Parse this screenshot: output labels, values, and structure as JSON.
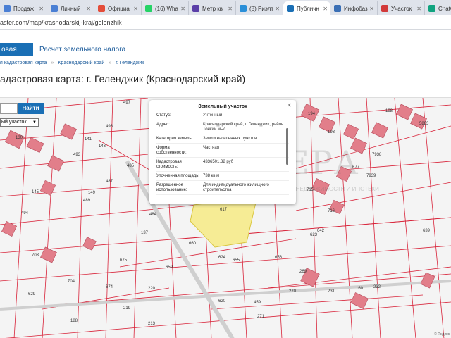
{
  "browser": {
    "tabs": [
      {
        "label": "Продаж",
        "color": "#4a7fd4"
      },
      {
        "label": "Личный",
        "color": "#4a7fd4"
      },
      {
        "label": "Официа",
        "color": "#e44d3a"
      },
      {
        "label": "(16) Wha",
        "color": "#25d366"
      },
      {
        "label": "Метр кв",
        "color": "#5b3fa8"
      },
      {
        "label": "(8) Риэлт",
        "color": "#2a8fd8"
      },
      {
        "label": "Публичн",
        "color": "#1a6fb5",
        "active": true
      },
      {
        "label": "Инфобаз",
        "color": "#3a6fb5"
      },
      {
        "label": "Участок",
        "color": "#d23a3a"
      },
      {
        "label": "ChatGPT",
        "color": "#10a37f"
      }
    ],
    "url": "aster.com/map/krasnodarskij-kraj/gelenzhik"
  },
  "site": {
    "nav_active": "овая карта",
    "nav_link": "Расчет земельного налога"
  },
  "breadcrumb": {
    "items": [
      "я кадастровая карта",
      "Краснодарский край",
      "г. Геленджик"
    ]
  },
  "page_title": "адастровая карта: г. Геленджик (Краснодарский край)",
  "map_controls": {
    "search_button": "Найти",
    "type_select": "ый участок"
  },
  "popup": {
    "title": "Земельный участок",
    "rows": [
      {
        "k": "Статус:",
        "v": "Учтенный"
      },
      {
        "k": "Адрес:",
        "v": "Краснодарский край, г. Геленджик, район Тонкий мыс"
      },
      {
        "k": "Категория земель:",
        "v": "Земли населенных пунктов"
      },
      {
        "k": "Форма собственности:",
        "v": "Частная"
      },
      {
        "k": "Кадастровая стоимость:",
        "v": "4336501.32 руб"
      },
      {
        "k": "Уточненная площадь:",
        "v": "738 кв.м"
      },
      {
        "k": "Разрешенное использование:",
        "v": "Для индивидуального жилищного строительства"
      }
    ]
  },
  "watermark": {
    "text": "ЭСТЕРА",
    "sub": "АГЕНТСТВО НЕДВИЖИМОСТИ И ИПОТЕКИ"
  },
  "map_labels": [
    "497",
    "496",
    "493",
    "485",
    "487",
    "489",
    "145",
    "149",
    "130",
    "141",
    "143",
    "494",
    "137",
    "484",
    "660",
    "624",
    "659",
    "675",
    "655",
    "656",
    "623",
    "269",
    "270",
    "231",
    "232",
    "220",
    "219",
    "213",
    "459",
    "271",
    "629",
    "704",
    "674",
    "703",
    "194",
    "193",
    "198",
    "5883",
    "7938",
    "7939",
    "715",
    "716",
    "677",
    "642",
    "160",
    "188",
    "639",
    "620",
    "617"
  ],
  "map_footer": "© Яндекс"
}
